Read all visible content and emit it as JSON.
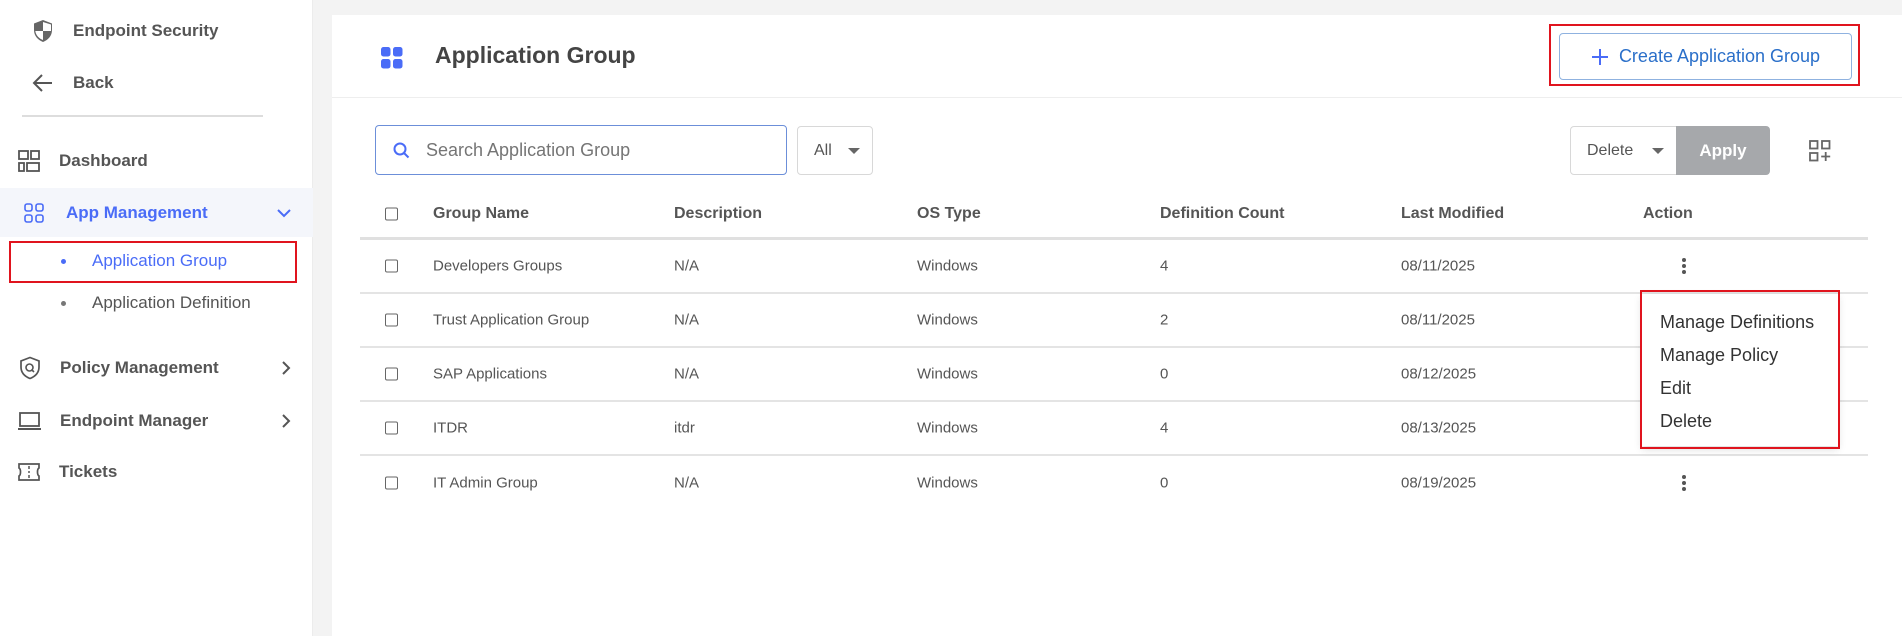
{
  "sidebar": {
    "app_title": "Endpoint Security",
    "back": "Back",
    "items": [
      {
        "label": "Dashboard"
      },
      {
        "label": "App Management",
        "sub": [
          {
            "label": "Application Group"
          },
          {
            "label": "Application Definition"
          }
        ]
      },
      {
        "label": "Policy Management"
      },
      {
        "label": "Endpoint Manager"
      },
      {
        "label": "Tickets"
      }
    ]
  },
  "header": {
    "title": "Application Group",
    "create_button": "Create Application Group"
  },
  "toolbar": {
    "search_placeholder": "Search Application Group",
    "filter_value": "All",
    "bulk_action": "Delete",
    "apply": "Apply"
  },
  "table": {
    "columns": [
      "Group Name",
      "Description",
      "OS Type",
      "Definition Count",
      "Last Modified",
      "Action"
    ],
    "rows": [
      {
        "name": "Developers Groups",
        "description": "N/A",
        "os": "Windows",
        "count": "4",
        "modified": "08/11/2025"
      },
      {
        "name": "Trust Application Group",
        "description": "N/A",
        "os": "Windows",
        "count": "2",
        "modified": "08/11/2025"
      },
      {
        "name": "SAP Applications",
        "description": "N/A",
        "os": "Windows",
        "count": "0",
        "modified": "08/12/2025"
      },
      {
        "name": "ITDR",
        "description": "itdr",
        "os": "Windows",
        "count": "4",
        "modified": "08/13/2025"
      },
      {
        "name": "IT Admin Group",
        "description": "N/A",
        "os": "Windows",
        "count": "0",
        "modified": "08/19/2025"
      }
    ]
  },
  "action_menu": [
    "Manage Definitions",
    "Manage Policy",
    "Edit",
    "Delete"
  ],
  "colors": {
    "accent": "#4a6cf7",
    "link": "#2a6fc9",
    "highlight": "#e0141e",
    "apply_disabled": "#a6a8ab"
  }
}
